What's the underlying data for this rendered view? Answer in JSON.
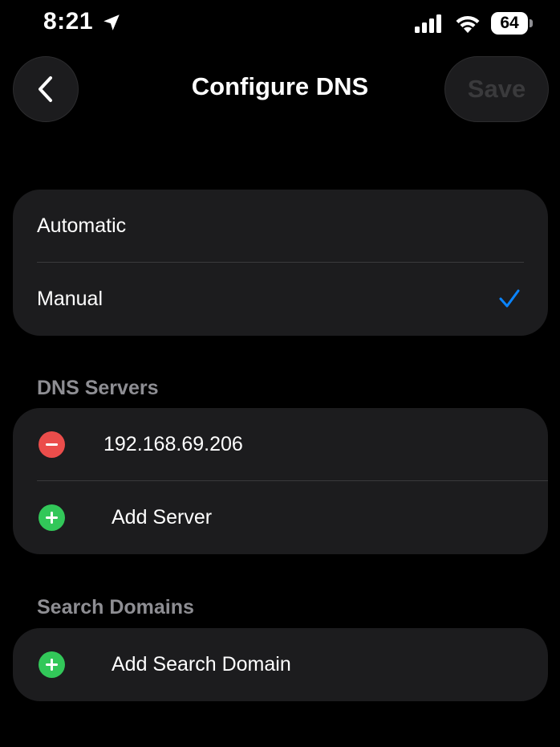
{
  "status_bar": {
    "time": "8:21",
    "battery": "64",
    "icons": [
      "location-arrow-icon",
      "signal-icon",
      "wifi-icon",
      "battery-icon"
    ]
  },
  "nav": {
    "back_icon": "chevron-left-icon",
    "title": "Configure DNS",
    "save_label": "Save"
  },
  "mode": {
    "options": [
      {
        "label": "Automatic",
        "selected": false
      },
      {
        "label": "Manual",
        "selected": true
      }
    ],
    "check_icon": "checkmark-icon"
  },
  "dns_servers": {
    "header": "DNS Servers",
    "servers": [
      "192.168.69.206"
    ],
    "add_label": "Add Server"
  },
  "search_domains": {
    "header": "Search Domains",
    "add_label": "Add Search Domain"
  },
  "colors": {
    "background": "#000000",
    "group": "#1c1c1e",
    "accent_blue": "#0a84ff",
    "delete_red": "#eb4d4b",
    "add_green": "#32c759",
    "secondary_text": "#8e8e93",
    "disabled_text": "#3a3a3c"
  }
}
